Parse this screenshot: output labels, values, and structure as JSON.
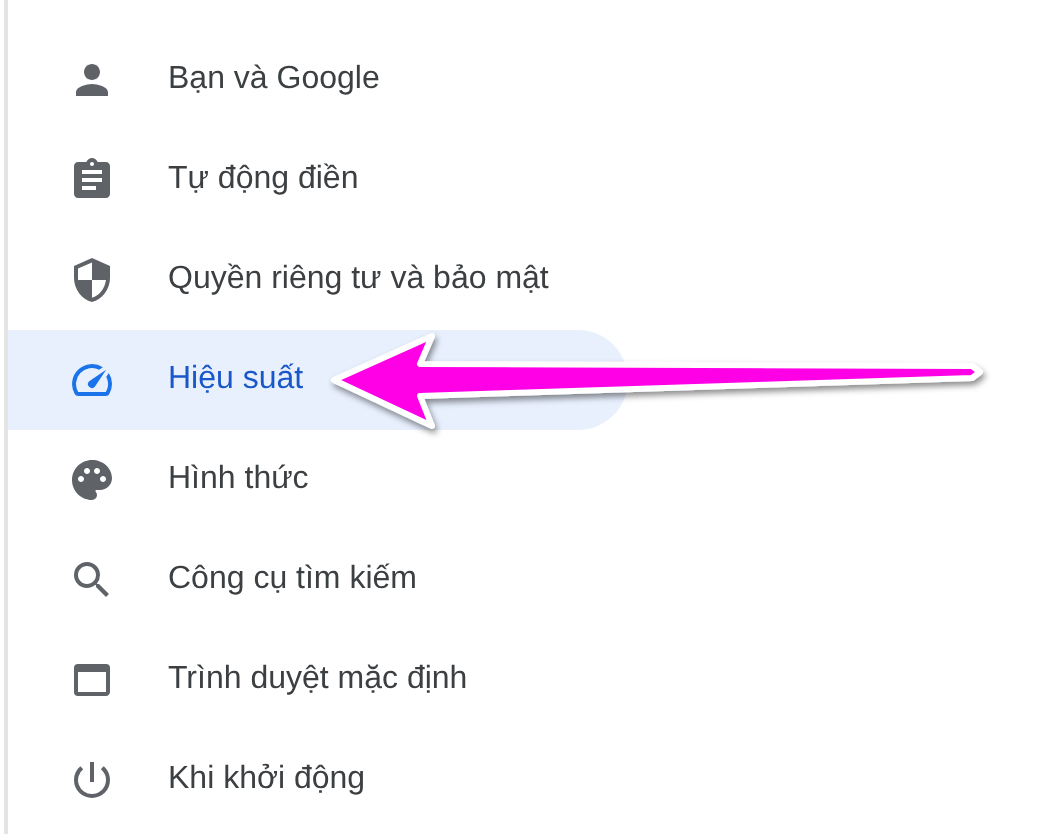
{
  "sidebar": {
    "items": [
      {
        "label": "Bạn và Google",
        "selected": false
      },
      {
        "label": "Tự động điền",
        "selected": false
      },
      {
        "label": "Quyền riêng tư và bảo mật",
        "selected": false
      },
      {
        "label": "Hiệu suất",
        "selected": true
      },
      {
        "label": "Hình thức",
        "selected": false
      },
      {
        "label": "Công cụ tìm kiếm",
        "selected": false
      },
      {
        "label": "Trình duyệt mặc định",
        "selected": false
      },
      {
        "label": "Khi khởi động",
        "selected": false
      }
    ]
  }
}
